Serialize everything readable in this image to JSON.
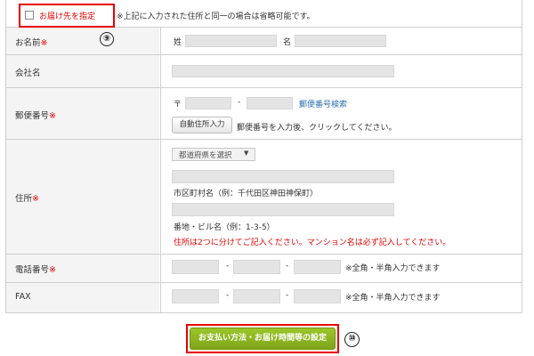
{
  "delivery": {
    "checkbox_label": "お届け先を指定",
    "note": "※上記に入力された住所と同一の場合は省略可能です。",
    "badge": "⑨"
  },
  "required_mark": "※",
  "name_row": {
    "label": "お名前",
    "sei": "姓",
    "mei": "名",
    "sei_value": "",
    "mei_value": ""
  },
  "company_row": {
    "label": "会社名",
    "value": ""
  },
  "postal_row": {
    "label": "郵便番号",
    "prefix": "〒",
    "dash": "-",
    "lookup_link": "郵便番号検索",
    "auto_button": "自動住所入力",
    "hint": "郵便番号を入力後、クリックしてください。"
  },
  "address_row": {
    "label": "住所",
    "pref_select": "都道府県を選択",
    "city_hint": "市区町村名（例：千代田区神田神保町）",
    "street_hint": "番地・ビル名（例：1-3-5）",
    "warning": "住所は2つに分けてご記入ください。マンション名は必ず記入してください。"
  },
  "phone_row": {
    "label": "電話番号",
    "dash": "-",
    "hint": "※全角・半角入力できます"
  },
  "fax_row": {
    "label": "FAX",
    "dash": "-",
    "hint": "※全角・半角入力できます"
  },
  "submit": {
    "label": "お支払い方法・お届け時間等の設定",
    "badge": "⑩"
  },
  "colors": {
    "highlight_border": "#e60000",
    "submit_green": "#8bb51d",
    "label_bg": "#f4f4f4"
  }
}
